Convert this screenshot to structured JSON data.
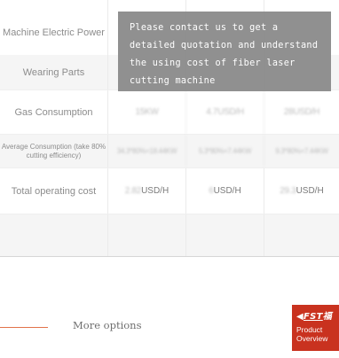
{
  "table": {
    "rows": [
      {
        "label": "Machine Electric Power",
        "values": [
          "",
          "",
          ""
        ]
      },
      {
        "label": "Wearing Parts",
        "values": [
          "",
          "",
          ""
        ]
      },
      {
        "label": "Gas Consumption",
        "values": [
          "15KW",
          "4.7USD/H",
          "28USD/H"
        ]
      },
      {
        "label": "Average Consumption (take 80% cutting efficiency)",
        "values": [
          "34.3*80%=18.44KW",
          "5.3*80%=7.44KW",
          "9.3*80%=7.44KW"
        ]
      },
      {
        "label": "Total operating cost",
        "values": [
          {
            "num": "2.82",
            "unit": "USD/H"
          },
          {
            "num": "6",
            "unit": "USD/H"
          },
          {
            "num": "29.3",
            "unit": "USD/H"
          }
        ]
      },
      {
        "label": "",
        "values": [
          "",
          "",
          ""
        ]
      }
    ]
  },
  "overlay": {
    "text": "Please contact us to get a detailed quotation and understand the using cost of fiber laser cutting machine"
  },
  "more": {
    "label": "More options"
  },
  "badge": {
    "brand_latin": "FST",
    "brand_cjk": "福",
    "line1": "Product",
    "line2": "Overview",
    "color": "#c9321f"
  },
  "accent_color": "#e2734a"
}
